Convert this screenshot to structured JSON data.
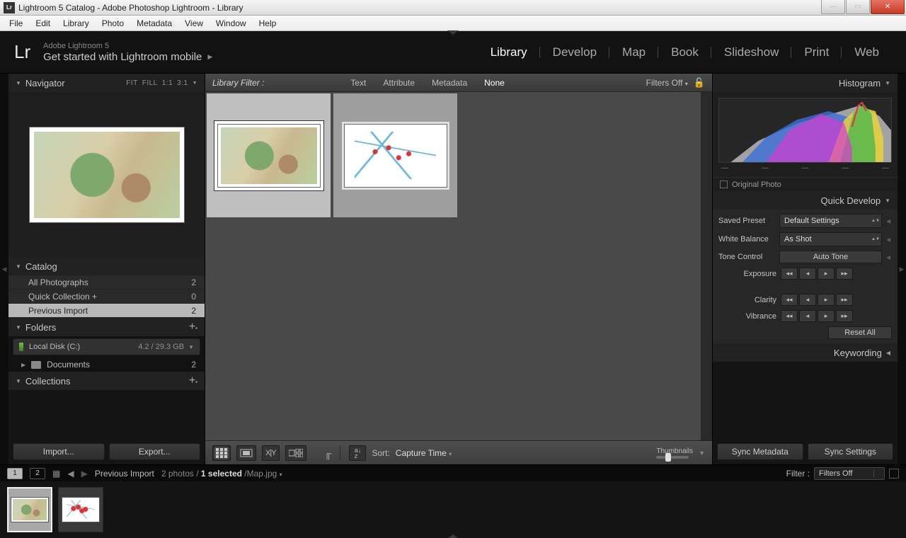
{
  "title": "Lightroom 5 Catalog - Adobe Photoshop Lightroom - Library",
  "menu": [
    "File",
    "Edit",
    "Library",
    "Photo",
    "Metadata",
    "View",
    "Window",
    "Help"
  ],
  "identity": {
    "logo": "Lr",
    "sub": "Adobe Lightroom 5",
    "main": "Get started with Lightroom mobile"
  },
  "modules": [
    "Library",
    "Develop",
    "Map",
    "Book",
    "Slideshow",
    "Print",
    "Web"
  ],
  "module_active": "Library",
  "navigator": {
    "title": "Navigator",
    "opts": [
      "FIT",
      "FILL",
      "1:1",
      "3:1"
    ]
  },
  "catalog": {
    "title": "Catalog",
    "rows": [
      {
        "label": "All Photographs",
        "count": 2
      },
      {
        "label": "Quick Collection  +",
        "count": 0
      },
      {
        "label": "Previous Import",
        "count": 2
      }
    ],
    "selected": 2
  },
  "folders": {
    "title": "Folders",
    "drive": {
      "name": "Local Disk (C:)",
      "capacity": "4.2 / 29.3 GB"
    },
    "items": [
      {
        "name": "Documents",
        "count": 2
      }
    ]
  },
  "collections": {
    "title": "Collections"
  },
  "left_buttons": {
    "import": "Import...",
    "export": "Export..."
  },
  "filterbar": {
    "label": "Library Filter :",
    "opts": [
      "Text",
      "Attribute",
      "Metadata",
      "None"
    ],
    "active": "None",
    "filters_off": "Filters Off"
  },
  "toolbar": {
    "sort_lbl": "Sort:",
    "sort_val": "Capture Time",
    "thumb_lbl": "Thumbnails"
  },
  "right": {
    "histogram": "Histogram",
    "original": "Original Photo",
    "qd": "Quick Develop",
    "preset_lbl": "Saved Preset",
    "preset_val": "Default Settings",
    "wb_lbl": "White Balance",
    "wb_val": "As Shot",
    "tone_lbl": "Tone Control",
    "tone_btn": "Auto Tone",
    "exposure": "Exposure",
    "clarity": "Clarity",
    "vibrance": "Vibrance",
    "reset": "Reset All",
    "keywording": "Keywording",
    "sync_meta": "Sync Metadata",
    "sync_set": "Sync Settings"
  },
  "status": {
    "source": "Previous Import",
    "count": "2 photos /",
    "sel": "1 selected",
    "file": "/Map.jpg",
    "filter_lbl": "Filter :",
    "filter_val": "Filters Off"
  }
}
